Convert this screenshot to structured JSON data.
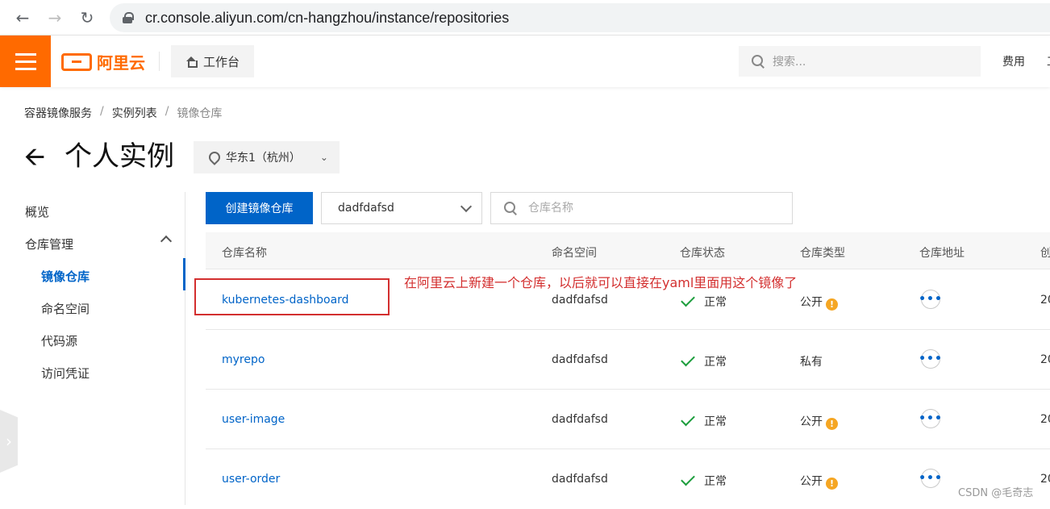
{
  "browser": {
    "url": "cr.console.aliyun.com/cn-hangzhou/instance/repositories"
  },
  "topbar": {
    "logo_text": "阿里云",
    "workbench_label": "工作台",
    "search_placeholder": "搜索...",
    "fee_label": "费用",
    "edge_label": "工"
  },
  "breadcrumb": [
    "容器镜像服务",
    "实例列表",
    "镜像仓库"
  ],
  "page": {
    "title": "个人实例",
    "region": "华东1（杭州）"
  },
  "sidebar": {
    "overview": "概览",
    "repo_mgmt": "仓库管理",
    "items": [
      "镜像仓库",
      "命名空间",
      "代码源",
      "访问凭证"
    ]
  },
  "toolbar": {
    "create_label": "创建镜像仓库",
    "namespace_value": "dadfdafsd",
    "search_placeholder": "仓库名称"
  },
  "table": {
    "headers": [
      "仓库名称",
      "命名空间",
      "仓库状态",
      "仓库类型",
      "仓库地址",
      "创"
    ],
    "rows": [
      {
        "name": "kubernetes-dashboard",
        "namespace": "dadfdafsd",
        "status": "正常",
        "type": "公开",
        "created": "20"
      },
      {
        "name": "myrepo",
        "namespace": "dadfdafsd",
        "status": "正常",
        "type": "私有",
        "created": "20"
      },
      {
        "name": "user-image",
        "namespace": "dadfdafsd",
        "status": "正常",
        "type": "公开",
        "created": "20"
      },
      {
        "name": "user-order",
        "namespace": "dadfdafsd",
        "status": "正常",
        "type": "公开",
        "created": "20"
      }
    ]
  },
  "annotation": "在阿里云上新建一个仓库，以后就可以直接在yaml里面用这个镜像了",
  "watermark": "CSDN @毛奇志",
  "colors": {
    "brand": "#ff6a00",
    "primary": "#0064c8",
    "success": "#1e9e3e",
    "warning": "#f5a623",
    "annotation": "#d32f2f"
  }
}
